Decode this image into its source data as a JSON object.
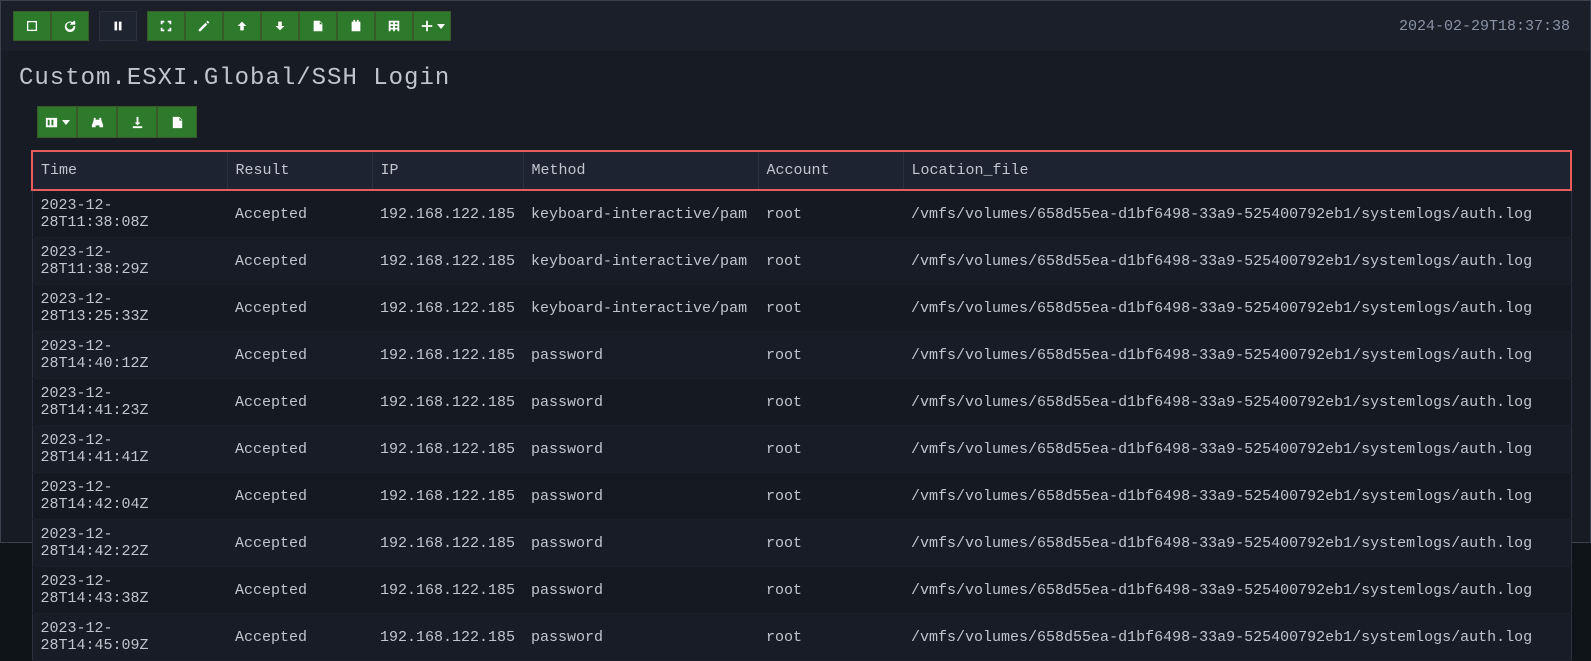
{
  "topbar": {
    "timestamp": "2024-02-29T18:37:38"
  },
  "title": "Custom.ESXI.Global/SSH Login",
  "table": {
    "headers": {
      "time": "Time",
      "result": "Result",
      "ip": "IP",
      "method": "Method",
      "account": "Account",
      "location": "Location_file"
    },
    "rows": [
      {
        "time": "2023-12-28T11:38:08Z",
        "result": "Accepted",
        "ip": "192.168.122.185",
        "method": "keyboard-interactive/pam",
        "account": "root",
        "location": "/vmfs/volumes/658d55ea-d1bf6498-33a9-525400792eb1/systemlogs/auth.log"
      },
      {
        "time": "2023-12-28T11:38:29Z",
        "result": "Accepted",
        "ip": "192.168.122.185",
        "method": "keyboard-interactive/pam",
        "account": "root",
        "location": "/vmfs/volumes/658d55ea-d1bf6498-33a9-525400792eb1/systemlogs/auth.log"
      },
      {
        "time": "2023-12-28T13:25:33Z",
        "result": "Accepted",
        "ip": "192.168.122.185",
        "method": "keyboard-interactive/pam",
        "account": "root",
        "location": "/vmfs/volumes/658d55ea-d1bf6498-33a9-525400792eb1/systemlogs/auth.log"
      },
      {
        "time": "2023-12-28T14:40:12Z",
        "result": "Accepted",
        "ip": "192.168.122.185",
        "method": "password",
        "account": "root",
        "location": "/vmfs/volumes/658d55ea-d1bf6498-33a9-525400792eb1/systemlogs/auth.log"
      },
      {
        "time": "2023-12-28T14:41:23Z",
        "result": "Accepted",
        "ip": "192.168.122.185",
        "method": "password",
        "account": "root",
        "location": "/vmfs/volumes/658d55ea-d1bf6498-33a9-525400792eb1/systemlogs/auth.log"
      },
      {
        "time": "2023-12-28T14:41:41Z",
        "result": "Accepted",
        "ip": "192.168.122.185",
        "method": "password",
        "account": "root",
        "location": "/vmfs/volumes/658d55ea-d1bf6498-33a9-525400792eb1/systemlogs/auth.log"
      },
      {
        "time": "2023-12-28T14:42:04Z",
        "result": "Accepted",
        "ip": "192.168.122.185",
        "method": "password",
        "account": "root",
        "location": "/vmfs/volumes/658d55ea-d1bf6498-33a9-525400792eb1/systemlogs/auth.log"
      },
      {
        "time": "2023-12-28T14:42:22Z",
        "result": "Accepted",
        "ip": "192.168.122.185",
        "method": "password",
        "account": "root",
        "location": "/vmfs/volumes/658d55ea-d1bf6498-33a9-525400792eb1/systemlogs/auth.log"
      },
      {
        "time": "2023-12-28T14:43:38Z",
        "result": "Accepted",
        "ip": "192.168.122.185",
        "method": "password",
        "account": "root",
        "location": "/vmfs/volumes/658d55ea-d1bf6498-33a9-525400792eb1/systemlogs/auth.log"
      },
      {
        "time": "2023-12-28T14:45:09Z",
        "result": "Accepted",
        "ip": "192.168.122.185",
        "method": "password",
        "account": "root",
        "location": "/vmfs/volumes/658d55ea-d1bf6498-33a9-525400792eb1/systemlogs/auth.log"
      }
    ]
  }
}
